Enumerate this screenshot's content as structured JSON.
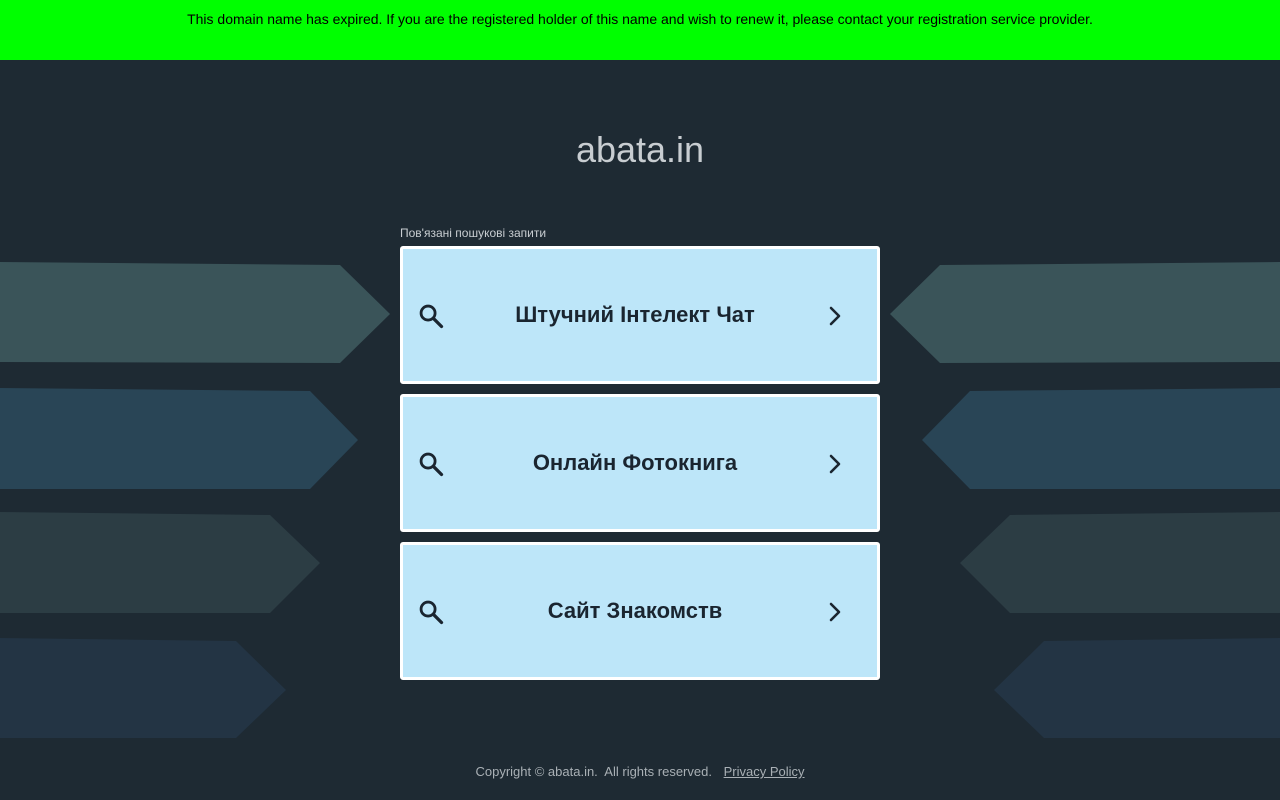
{
  "banner": {
    "text": "This domain name has expired. If you are the registered holder of this name and wish to renew it, please contact your registration service provider."
  },
  "site": {
    "domain": "abata.in"
  },
  "related": {
    "label": "Пов'язані пошукові запити",
    "links": [
      {
        "label": "Штучний Інтелект Чат",
        "icon": "search-icon",
        "action_icon": "chevron-right-icon"
      },
      {
        "label": "Онлайн Фотокнига",
        "icon": "search-icon",
        "action_icon": "chevron-right-icon"
      },
      {
        "label": "Сайт Знакомств",
        "icon": "search-icon",
        "action_icon": "chevron-right-icon"
      }
    ]
  },
  "footer": {
    "copyright": "Copyright © abata.in.  All rights reserved.",
    "privacy_label": "Privacy Policy"
  },
  "colors": {
    "banner_bg": "#00ff00",
    "page_bg": "#1e2a33",
    "link_bg": "#bde6f9",
    "link_text": "#1a2530"
  }
}
